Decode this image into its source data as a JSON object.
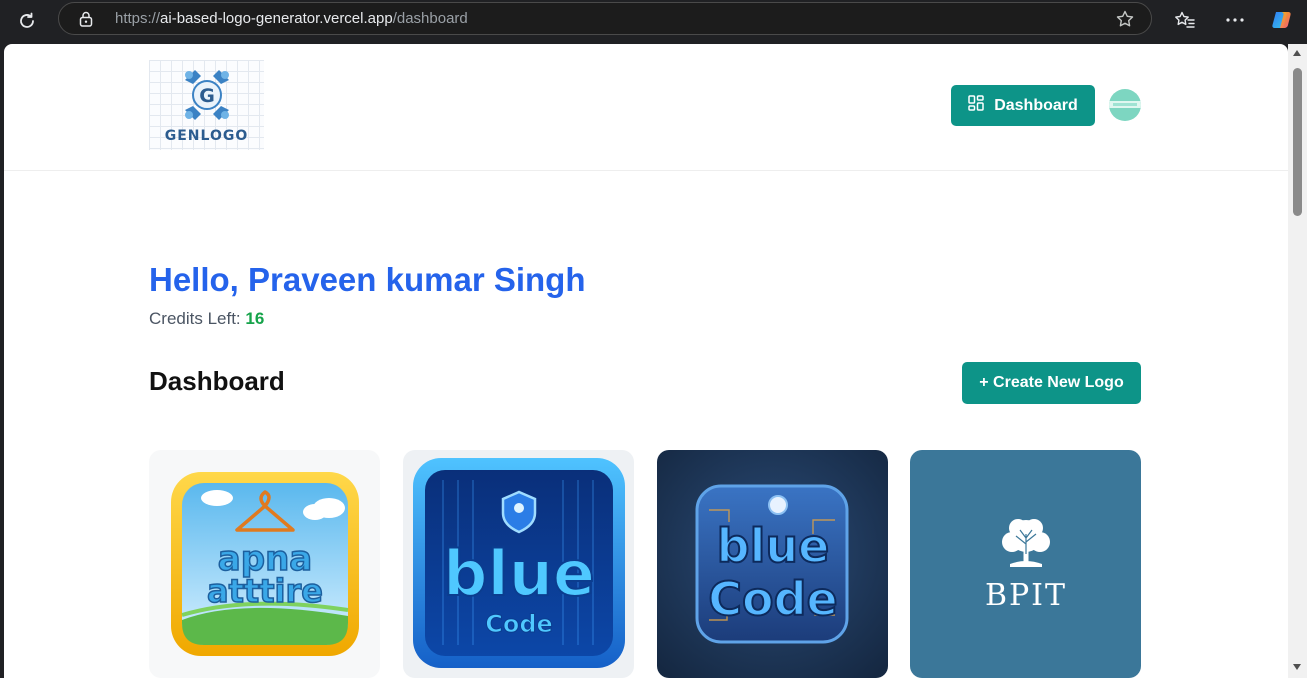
{
  "browser": {
    "url_prefix": "https://",
    "url_host": "ai-based-logo-generator.vercel.app",
    "url_path": "/dashboard"
  },
  "header": {
    "logo_text": "GENLOGO",
    "logo_letter": "G",
    "dashboard_label": "Dashboard"
  },
  "main": {
    "greeting": "Hello, Praveen kumar Singh",
    "credits_label": "Credits Left: ",
    "credits_value": "16",
    "section_title": "Dashboard",
    "create_label": "+ Create New Logo"
  },
  "logos": [
    {
      "line1": "apna",
      "line2": "atttire"
    },
    {
      "line1": "blue",
      "line2": "Code"
    },
    {
      "line1": "blue",
      "line2": "Code"
    },
    {
      "line1": "BPIT"
    }
  ],
  "colors": {
    "accent": "#0d9488",
    "greeting": "#2563eb",
    "credits": "#16a34a"
  }
}
